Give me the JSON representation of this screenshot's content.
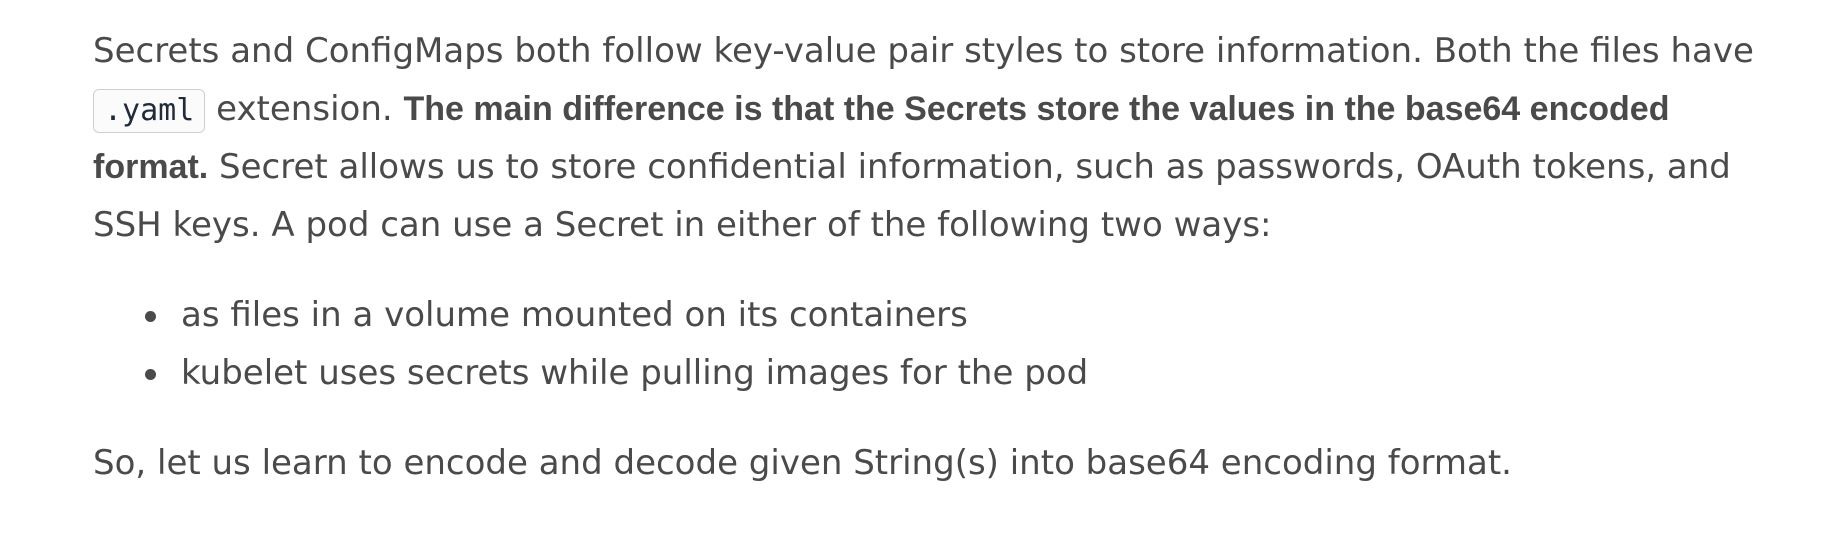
{
  "article": {
    "paragraph1": {
      "text_a": "Secrets and ConfigMaps both follow key-value pair styles to store information. Both the files have ",
      "code": ".yaml",
      "text_b": " extension. ",
      "bold": "The main difference is that the Secrets store the values in the base64 encoded format.",
      "text_c": " Secret allows us to store confidential information, such as passwords, OAuth tokens, and SSH keys. A pod can use a Secret in either of the following two ways:"
    },
    "bullets": [
      "as files in a volume mounted on its containers",
      "kubelet uses secrets while pulling images for the pod"
    ],
    "paragraph2": "So, let us learn to encode and decode given String(s) into base64 encoding format."
  }
}
